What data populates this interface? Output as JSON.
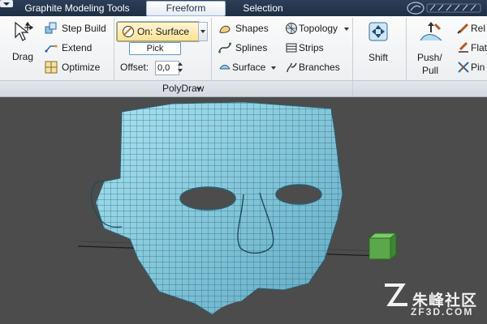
{
  "tabs": {
    "graphite": "Graphite Modeling Tools",
    "freeform": "Freeform",
    "selection": "Selection"
  },
  "polydraw": {
    "drag": "Drag",
    "step_build": "Step Build",
    "extend": "Extend",
    "optimize": "Optimize",
    "on_surface": "On: Surface",
    "pick": "Pick",
    "offset_label": "Offset:",
    "offset_value": "0,0",
    "shapes": "Shapes",
    "splines": "Splines",
    "surface": "Surface",
    "topology": "Topology",
    "strips": "Strips",
    "branches": "Branches",
    "panel_label": "PolyDraw"
  },
  "paint": {
    "shift": "Shift",
    "push_pull_line1": "Push/",
    "push_pull_line2": "Pull",
    "relax": "Rel",
    "flatten": "Flat",
    "pinch": "Pin"
  },
  "watermark": {
    "brand": "朱峰社区",
    "site": "ZF3D.COM"
  },
  "colors": {
    "ribbon_bg": "#eef0f3",
    "active_button": "#ffe391",
    "mesh": "#8fd6e8",
    "viewport_bg": "#4c4c4c"
  }
}
